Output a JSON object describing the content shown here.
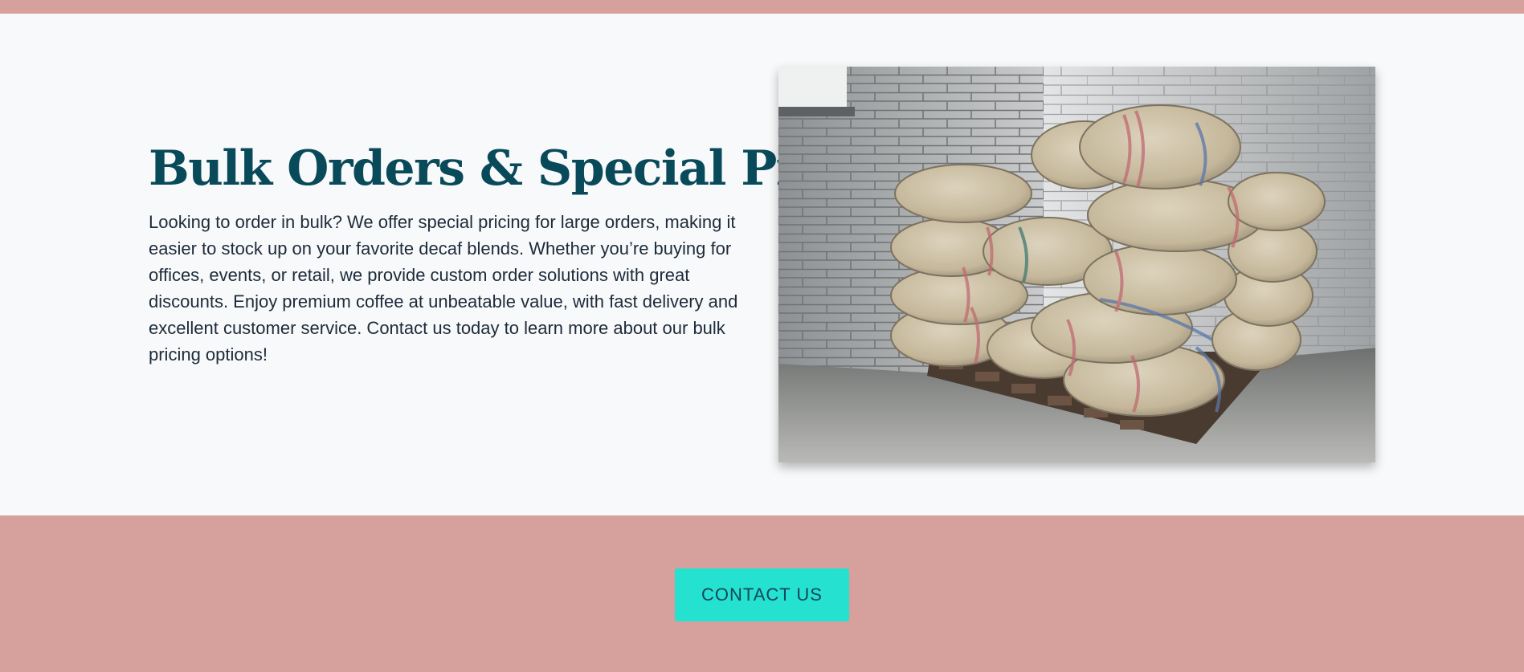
{
  "feature": {
    "heading": "Bulk Orders & Special Pricing",
    "body": "Looking to order in bulk? We offer special pricing for large orders, making it easier to stock up on your favorite decaf blends. Whether you’re buying for offices, events, or retail, we provide custom order solutions with great discounts. Enjoy premium coffee at unbeatable value, with fast delivery and excellent customer service. Contact us today to learn more about our bulk pricing options!",
    "image_subject": "stacked burlap coffee sacks on a wooden pallet"
  },
  "cta": {
    "button_label": "CONTACT US"
  },
  "colors": {
    "accent_band": "#d6a09c",
    "heading": "#084a5a",
    "button_bg": "#24e2cf",
    "button_text": "#14465a",
    "page_bg": "#f8f9fa"
  }
}
